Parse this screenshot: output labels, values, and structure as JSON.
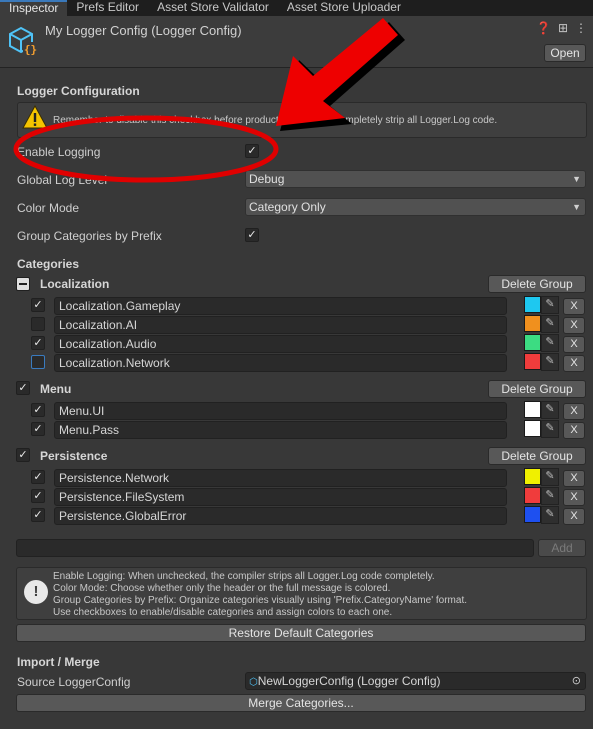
{
  "tabs": [
    "Inspector",
    "Prefs Editor",
    "Asset Store Validator",
    "Asset Store Uploader"
  ],
  "header": {
    "title": "My Logger Config (Logger Config)",
    "open_label": "Open",
    "icons": [
      "help-icon",
      "sliders-icon",
      "more-icon"
    ]
  },
  "logger_config": {
    "section_title": "Logger Configuration",
    "warning_text": "Remember to disable this checkbox before production builds to completely strip all Logger.Log code.",
    "enable_logging_label": "Enable Logging",
    "enable_logging": true,
    "global_log_level_label": "Global Log Level",
    "global_log_level": "Debug",
    "color_mode_label": "Color Mode",
    "color_mode": "Category Only",
    "group_by_prefix_label": "Group Categories by Prefix",
    "group_by_prefix": true
  },
  "categories": {
    "section_title": "Categories",
    "delete_group_label": "Delete Group",
    "remove_label": "X",
    "groups": [
      {
        "name": "Localization",
        "state": "mixed",
        "items": [
          {
            "name": "Localization.Gameplay",
            "enabled": true,
            "color": "#1ec8f0"
          },
          {
            "name": "Localization.AI",
            "enabled": false,
            "color": "#f0901e"
          },
          {
            "name": "Localization.Audio",
            "enabled": true,
            "color": "#3cdc82"
          },
          {
            "name": "Localization.Network",
            "enabled": false,
            "color": "#f03c3c"
          }
        ]
      },
      {
        "name": "Menu",
        "state": "checked",
        "items": [
          {
            "name": "Menu.UI",
            "enabled": true,
            "color": "#ffffff"
          },
          {
            "name": "Menu.Pass",
            "enabled": true,
            "color": "#ffffff"
          }
        ]
      },
      {
        "name": "Persistence",
        "state": "checked",
        "items": [
          {
            "name": "Persistence.Network",
            "enabled": true,
            "color": "#f0f000"
          },
          {
            "name": "Persistence.FileSystem",
            "enabled": true,
            "color": "#f03c3c"
          },
          {
            "name": "Persistence.GlobalError",
            "enabled": true,
            "color": "#1e50f0"
          }
        ]
      }
    ],
    "new_category_value": "",
    "add_label": "Add"
  },
  "info": {
    "lines": [
      "Enable Logging: When unchecked, the compiler strips all Logger.Log code completely.",
      "Color Mode: Choose whether only the header or the full message is colored.",
      "Group Categories by Prefix: Organize categories visually using 'Prefix.CategoryName' format.",
      "Use checkboxes to enable/disable categories and assign colors to each one."
    ]
  },
  "restore_label": "Restore Default Categories",
  "import_merge": {
    "section_title": "Import / Merge",
    "source_label": "Source LoggerConfig",
    "source_value": "NewLoggerConfig (Logger Config)",
    "merge_label": "Merge Categories..."
  }
}
